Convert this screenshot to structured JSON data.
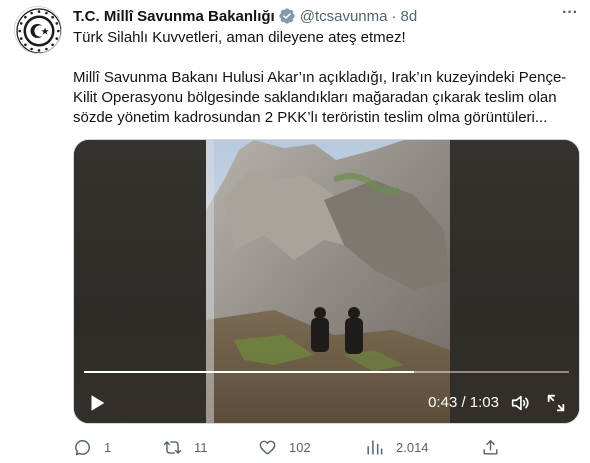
{
  "tweet": {
    "author_name": "T.C. Millî Savunma Bakanlığı",
    "handle": "@tcsavunma",
    "separator": "·",
    "time": "8d",
    "more_label": "···",
    "text_line1": "Türk Silahlı Kuvvetleri, aman dileyene ateş etmez!",
    "text_body": "Millî Savunma Bakanı Hulusi Akar’ın açıkladığı, Irak’ın kuzeyindeki Pençe-Kilit Operasyonu bölgesinde saklandıkları mağaradan çıkarak teslim olan sözde yönetim kadrosundan 2 PKK’lı teröristin teslim olma görüntüleri..."
  },
  "video": {
    "current_time": "0:43",
    "duration": "1:03",
    "time_text": "0:43 / 1:03",
    "progress_fraction": 0.68
  },
  "actions": {
    "reply_count": "1",
    "retweet_count": "11",
    "like_count": "102",
    "view_count": "2.014"
  },
  "colors": {
    "verified_badge": "#829aab",
    "secondary_text": "#536471",
    "primary_text": "#0f1419"
  },
  "icons": [
    "ministry-logo-icon",
    "verified-badge-icon",
    "more-icon",
    "play-icon",
    "volume-icon",
    "fullscreen-icon",
    "reply-icon",
    "retweet-icon",
    "like-icon",
    "views-icon",
    "share-icon"
  ]
}
